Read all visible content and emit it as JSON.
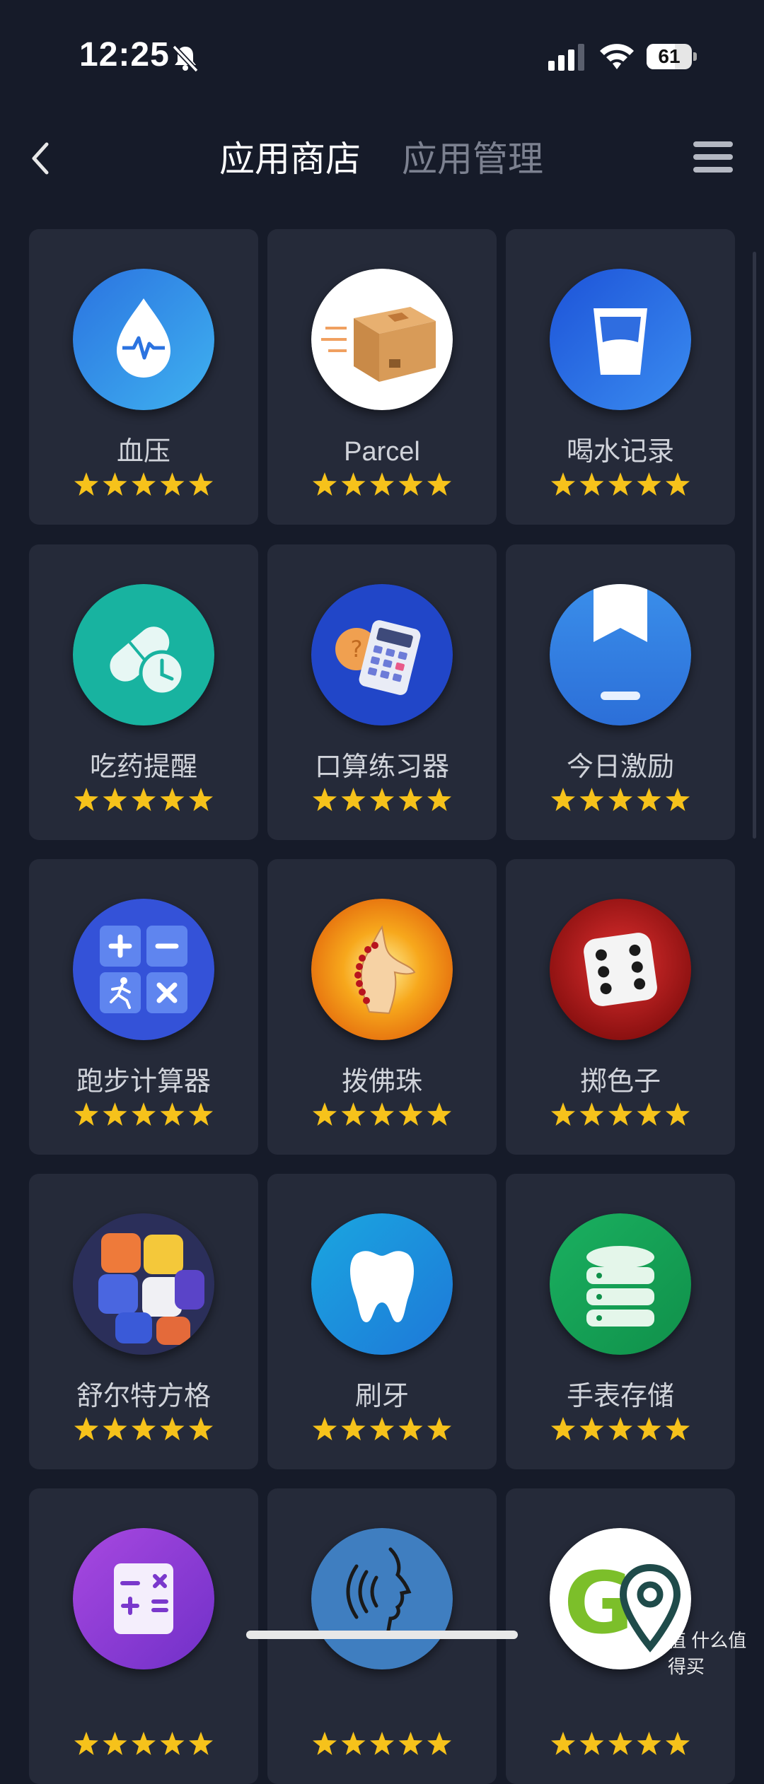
{
  "status_bar": {
    "time": "12:25",
    "battery": "61",
    "icons": [
      "bell-slash-icon",
      "cellular-signal-icon",
      "wifi-icon",
      "battery-icon"
    ]
  },
  "header": {
    "tabs": [
      "应用商店",
      "应用管理"
    ],
    "active_tab": 0,
    "icons": [
      "chevron-left-icon",
      "hamburger-menu-icon"
    ]
  },
  "apps": [
    {
      "name": "血压",
      "rating": 5,
      "icon": "blood-pressure-icon"
    },
    {
      "name": "Parcel",
      "rating": 5,
      "icon": "parcel-box-icon"
    },
    {
      "name": "喝水记录",
      "rating": 5,
      "icon": "water-glass-icon"
    },
    {
      "name": "吃药提醒",
      "rating": 5,
      "icon": "pill-clock-icon"
    },
    {
      "name": "口算练习器",
      "rating": 5,
      "icon": "calculator-icon"
    },
    {
      "name": "今日激励",
      "rating": 5,
      "icon": "bookmark-icon"
    },
    {
      "name": "跑步计算器",
      "rating": 5,
      "icon": "running-calculator-icon"
    },
    {
      "name": "拨佛珠",
      "rating": 5,
      "icon": "prayer-beads-icon"
    },
    {
      "name": "掷色子",
      "rating": 5,
      "icon": "dice-icon"
    },
    {
      "name": "舒尔特方格",
      "rating": 5,
      "icon": "cube-puzzle-icon"
    },
    {
      "name": "刷牙",
      "rating": 5,
      "icon": "tooth-icon"
    },
    {
      "name": "手表存储",
      "rating": 5,
      "icon": "database-icon"
    },
    {
      "name": "",
      "rating": 5,
      "icon": "math-symbols-icon"
    },
    {
      "name": "",
      "rating": 5,
      "icon": "voice-speak-icon"
    },
    {
      "name": "",
      "rating": 5,
      "icon": "go-location-icon"
    }
  ],
  "watermark": "值 什么值得买",
  "colors": {
    "background": "#161b29",
    "card": "#252a39",
    "star": "#f6c21b",
    "inactive_tab": "#7c8190"
  }
}
